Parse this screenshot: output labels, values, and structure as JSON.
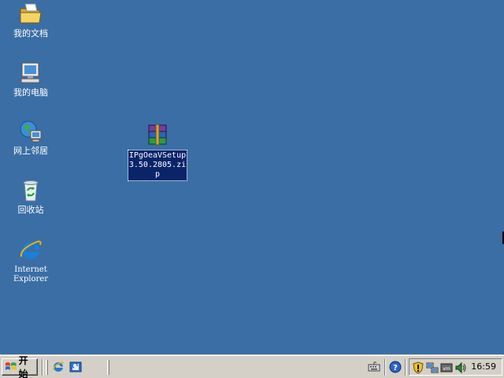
{
  "desktop": {
    "background_color": "#3a6ea5",
    "icons": [
      {
        "label": "我的文档",
        "icon": "my-documents-folder-icon"
      },
      {
        "label": "我的电脑",
        "icon": "my-computer-icon"
      },
      {
        "label": "网上邻居",
        "icon": "network-places-icon"
      },
      {
        "label": "回收站",
        "icon": "recycle-bin-icon"
      },
      {
        "label": "Internet\nExplorer",
        "icon": "internet-explorer-icon"
      },
      {
        "label": "IPgOeaVSetup3.50.2805.zip",
        "icon": "winrar-archive-icon",
        "selected": true
      }
    ]
  },
  "taskbar": {
    "start_label": "开始",
    "quick_launch": [
      "internet-explorer-icon",
      "outlook-express-icon"
    ],
    "tray_icons": [
      "security-shield-icon",
      "network-icon",
      "vmware-tools-icon",
      "sound-icon"
    ],
    "misc_icons": [
      "keyboard-icon",
      "help-icon"
    ],
    "clock": "16:59"
  }
}
